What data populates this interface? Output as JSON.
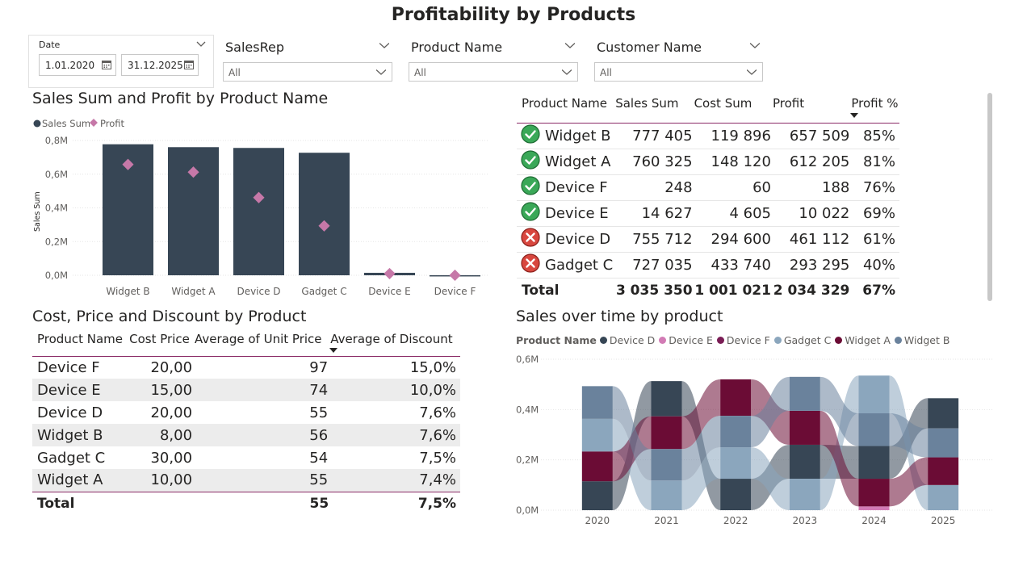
{
  "page_title": "Profitability by Products",
  "slicers": {
    "date": {
      "label": "Date",
      "from": "1.01.2020",
      "to": "31.12.2025"
    },
    "salesrep": {
      "label": "SalesRep",
      "value": "All"
    },
    "product": {
      "label": "Product Name",
      "value": "All"
    },
    "customer": {
      "label": "Customer Name",
      "value": "All"
    }
  },
  "bar_chart": {
    "title": "Sales Sum and Profit by Product Name",
    "legend": [
      "Sales Sum",
      "Profit"
    ],
    "ylabel": "Sales Sum",
    "yticks": [
      "0,8M",
      "0,6M",
      "0,4M",
      "0,2M",
      "0,0M"
    ]
  },
  "profit_table": {
    "headers": [
      "Product Name",
      "Sales Sum",
      "Cost Sum",
      "Profit",
      "Profit %"
    ],
    "rows": [
      {
        "status": "ok",
        "name": "Widget B",
        "sales": "777 405",
        "cost": "119 896",
        "profit": "657 509",
        "pct": "85%"
      },
      {
        "status": "ok",
        "name": "Widget A",
        "sales": "760 325",
        "cost": "148 120",
        "profit": "612 205",
        "pct": "81%"
      },
      {
        "status": "ok",
        "name": "Device F",
        "sales": "248",
        "cost": "60",
        "profit": "188",
        "pct": "76%"
      },
      {
        "status": "ok",
        "name": "Device E",
        "sales": "14 627",
        "cost": "4 605",
        "profit": "10 022",
        "pct": "69%"
      },
      {
        "status": "bad",
        "name": "Device D",
        "sales": "755 712",
        "cost": "294 600",
        "profit": "461 112",
        "pct": "61%"
      },
      {
        "status": "bad",
        "name": "Gadget C",
        "sales": "727 035",
        "cost": "433 740",
        "profit": "293 295",
        "pct": "40%"
      }
    ],
    "total": {
      "label": "Total",
      "sales": "3 035 350",
      "cost": "1 001 021",
      "profit": "2 034 329",
      "pct": "67%"
    }
  },
  "cost_table": {
    "title": "Cost, Price and Discount by Product",
    "headers": [
      "Product Name",
      "Cost Price",
      "Average of Unit Price",
      "Average of Discount"
    ],
    "rows": [
      {
        "name": "Device F",
        "cost": "20,00",
        "price": "97",
        "discount": "15,0%"
      },
      {
        "name": "Device E",
        "cost": "15,00",
        "price": "74",
        "discount": "10,0%"
      },
      {
        "name": "Device D",
        "cost": "20,00",
        "price": "55",
        "discount": "7,6%"
      },
      {
        "name": "Widget B",
        "cost": "8,00",
        "price": "56",
        "discount": "7,6%"
      },
      {
        "name": "Gadget C",
        "cost": "30,00",
        "price": "54",
        "discount": "7,5%"
      },
      {
        "name": "Widget A",
        "cost": "10,00",
        "price": "55",
        "discount": "7,4%"
      }
    ],
    "total": {
      "label": "Total",
      "price": "55",
      "discount": "7,5%"
    }
  },
  "ribbon_chart": {
    "title": "Sales over time by product",
    "legend_title": "Product Name",
    "yticks": [
      "0,6M",
      "0,4M",
      "0,2M",
      "0,0M"
    ]
  },
  "chart_data": [
    {
      "type": "bar",
      "title": "Sales Sum and Profit by Product Name",
      "ylabel": "Sales Sum",
      "ylim": [
        0,
        800000
      ],
      "categories": [
        "Widget B",
        "Widget A",
        "Device D",
        "Gadget C",
        "Device E",
        "Device F"
      ],
      "series": [
        {
          "name": "Sales Sum",
          "kind": "bar",
          "color": "#374655",
          "values": [
            777405,
            760325,
            755712,
            727035,
            14627,
            248
          ]
        },
        {
          "name": "Profit",
          "kind": "marker",
          "color": "#c678a8",
          "values": [
            657509,
            612205,
            461112,
            293295,
            10022,
            188
          ]
        }
      ]
    },
    {
      "type": "area",
      "title": "Sales over time by product",
      "x": [
        "2020",
        "2021",
        "2022",
        "2023",
        "2024",
        "2025"
      ],
      "ylim": [
        0,
        600000
      ],
      "series": [
        {
          "name": "Device D",
          "color": "#374655",
          "values": [
            115000,
            140000,
            125000,
            135000,
            130000,
            120000
          ]
        },
        {
          "name": "Device E",
          "color": "#d27bb5",
          "values": [
            0,
            0,
            0,
            0,
            15000,
            0
          ]
        },
        {
          "name": "Device F",
          "color": "#7a1d55",
          "values": [
            0,
            0,
            0,
            0,
            0,
            0
          ]
        },
        {
          "name": "Gadget C",
          "color": "#8ba6bd",
          "values": [
            130000,
            118000,
            125000,
            125000,
            150000,
            100000
          ]
        },
        {
          "name": "Widget A",
          "color": "#6b0c35",
          "values": [
            118000,
            130000,
            145000,
            135000,
            110000,
            110000
          ]
        },
        {
          "name": "Widget B",
          "color": "#6a829c",
          "values": [
            130000,
            125000,
            125000,
            135000,
            130000,
            115000
          ]
        }
      ]
    }
  ],
  "colors": {
    "accent": "#8a2a66",
    "ok": "#3aa858",
    "bad": "#d8473f",
    "band": "#ececec"
  }
}
